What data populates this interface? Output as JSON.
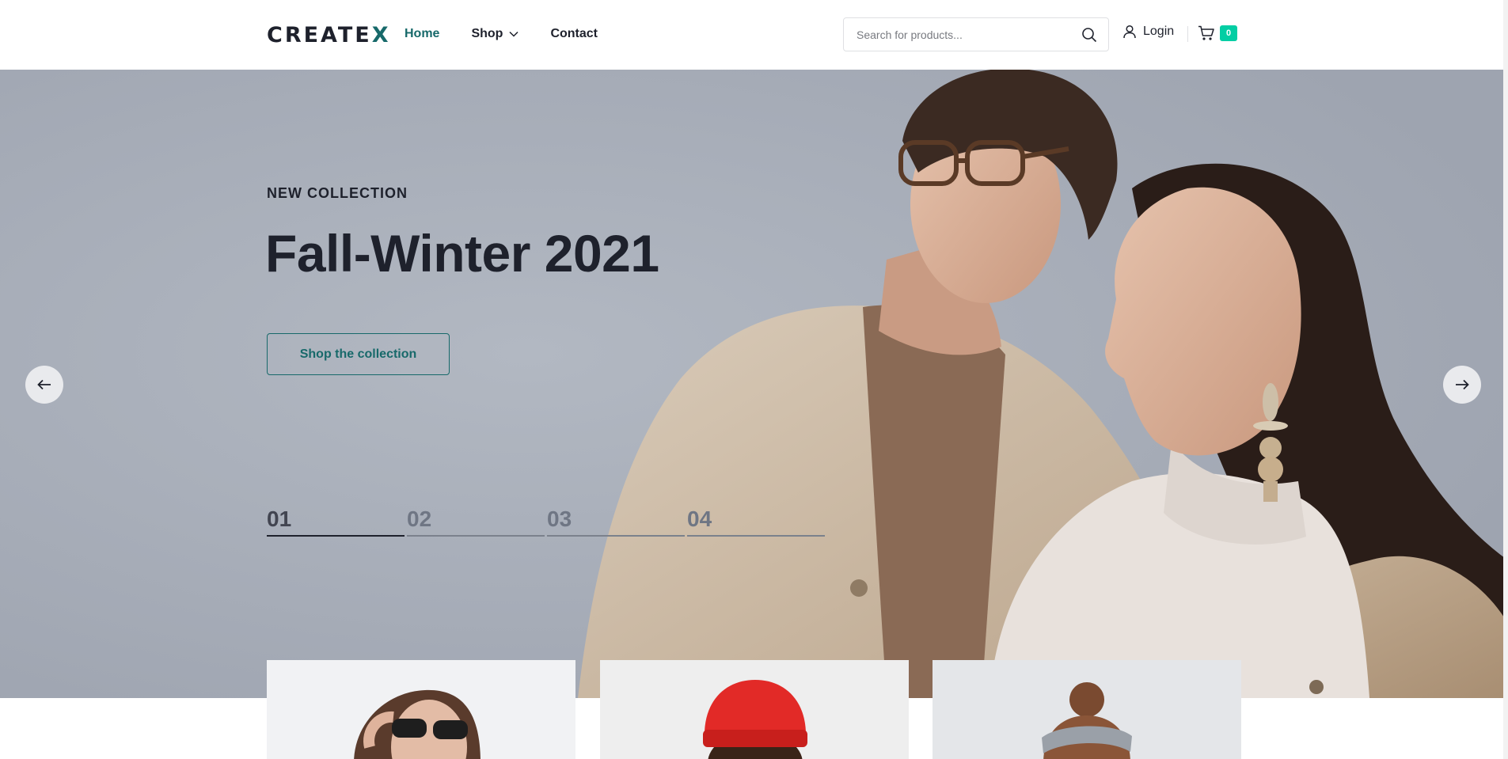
{
  "header": {
    "logo_main": "CREATE",
    "logo_x": "X",
    "nav": [
      {
        "label": "Home"
      },
      {
        "label": "Shop"
      },
      {
        "label": "Contact"
      }
    ],
    "search_placeholder": "Search for products...",
    "login_label": "Login",
    "cart_count": "0"
  },
  "hero": {
    "kicker": "NEW COLLECTION",
    "title": "Fall-Winter 2021",
    "cta_label": "Shop the collection",
    "slides": [
      {
        "label": "01"
      },
      {
        "label": "02"
      },
      {
        "label": "03"
      },
      {
        "label": "04"
      }
    ],
    "active_slide": "01"
  },
  "colors": {
    "accent": "#17696a",
    "badge": "#03cea4",
    "hero_background": "#a6acb7",
    "text_dark": "#1e212c"
  },
  "icons": [
    "search-icon",
    "user-icon",
    "cart-icon",
    "chevron-down-icon",
    "arrow-left-icon",
    "arrow-right-icon"
  ]
}
